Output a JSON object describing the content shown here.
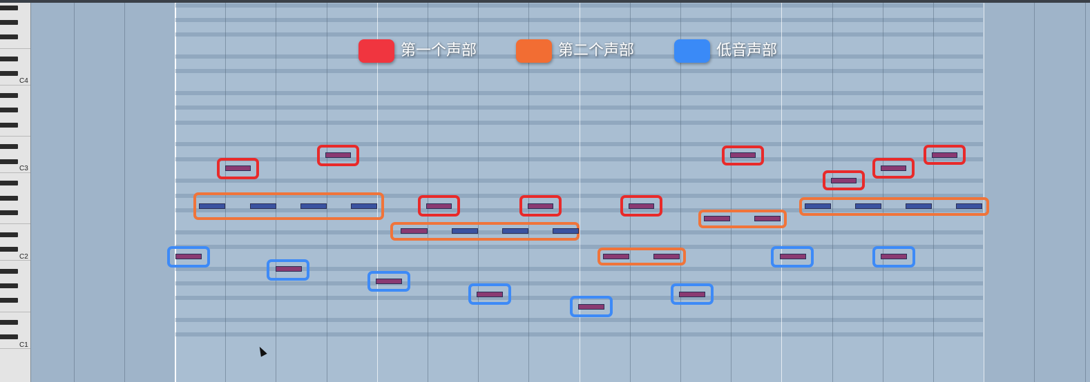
{
  "piano": {
    "octave_labels": [
      "C4",
      "C3",
      "C2",
      "C1"
    ]
  },
  "legend": [
    {
      "label": "第一个声部",
      "color": "#f0353f"
    },
    {
      "label": "第二个声部",
      "color": "#f26d33"
    },
    {
      "label": "低音声部",
      "color": "#3a8af7"
    }
  ],
  "colors": {
    "note_default": "#8a3a72",
    "note_selected": "#3a52a0",
    "region_background": "#a9bed2",
    "editor_background": "#9fb4c9"
  }
}
